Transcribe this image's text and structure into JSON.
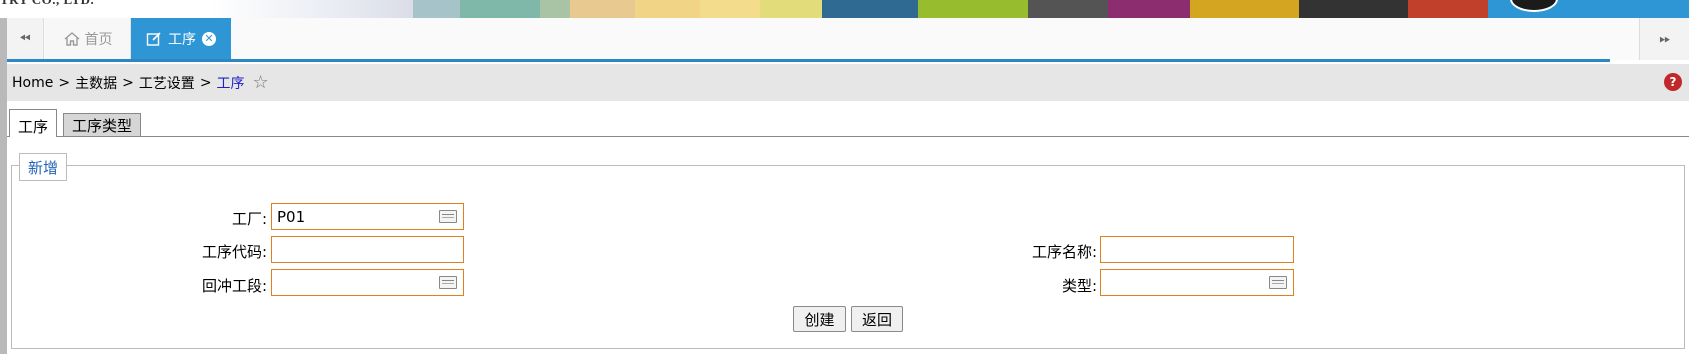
{
  "banner": {
    "company_text": "TRY CO., LTD.",
    "swatches": [
      {
        "color": "#a5c3c9",
        "from": 413,
        "to": 460
      },
      {
        "color": "#7fb7a9",
        "from": 460,
        "to": 540
      },
      {
        "color": "#a8c4a4",
        "from": 540,
        "to": 570
      },
      {
        "color": "#e8c98f",
        "from": 570,
        "to": 635
      },
      {
        "color": "#f2d487",
        "from": 635,
        "to": 700
      },
      {
        "color": "#f3dc8c",
        "from": 700,
        "to": 760
      },
      {
        "color": "#e3dc7a",
        "from": 760,
        "to": 822
      },
      {
        "color": "#2f6a93",
        "from": 822,
        "to": 918
      },
      {
        "color": "#97bc2e",
        "from": 918,
        "to": 1028
      },
      {
        "color": "#545454",
        "from": 1028,
        "to": 1108
      },
      {
        "color": "#8b2d6e",
        "from": 1108,
        "to": 1190
      },
      {
        "color": "#d4a520",
        "from": 1190,
        "to": 1299
      },
      {
        "color": "#333333",
        "from": 1299,
        "to": 1408
      },
      {
        "color": "#c0402c",
        "from": 1408,
        "to": 1488
      },
      {
        "color": "#2f96d6",
        "from": 1488,
        "to": 1689
      }
    ]
  },
  "tabbar": {
    "prev_icon": "double-chevron-left-icon",
    "next_icon": "double-chevron-right-icon",
    "home_label": "首页",
    "active_label": "工序",
    "accent": "#2f96d6"
  },
  "breadcrumb": {
    "items": [
      "Home",
      "主数据",
      "工艺设置"
    ],
    "current": "工序",
    "separator": ">",
    "star_icon": "star-outline-icon",
    "help_icon": "question-icon"
  },
  "form_tabs": [
    "工序",
    "工序类型"
  ],
  "fieldset": {
    "legend": "新增",
    "fields": {
      "plant": {
        "label": "工厂:",
        "value": "P01"
      },
      "op_code": {
        "label": "工序代码:",
        "value": ""
      },
      "backflush": {
        "label": "回冲工段:",
        "value": ""
      },
      "op_name": {
        "label": "工序名称:",
        "value": ""
      },
      "type": {
        "label": "类型:",
        "value": ""
      }
    }
  },
  "buttons": {
    "create": "创建",
    "back": "返回"
  }
}
